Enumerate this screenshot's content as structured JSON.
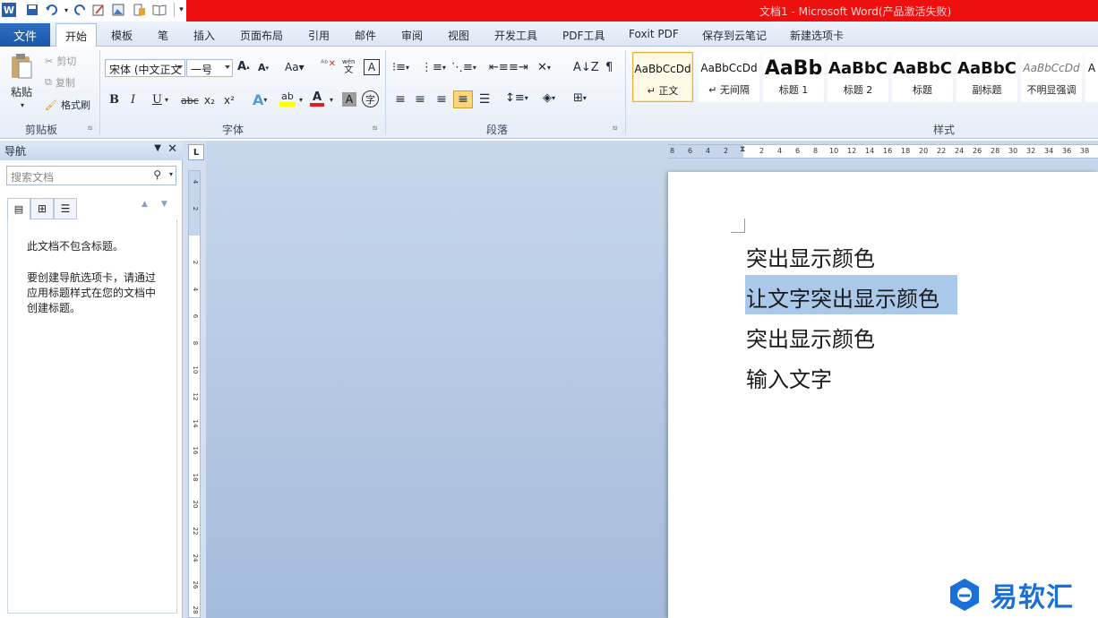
{
  "window": {
    "title": "文档1 - Microsoft Word(产品激活失败)"
  },
  "tabs": {
    "file": "文件",
    "home": "开始",
    "others": [
      "模板",
      "笔",
      "插入",
      "页面布局",
      "引用",
      "邮件",
      "审阅",
      "视图",
      "开发工具",
      "PDF工具",
      "Foxit PDF",
      "保存到云笔记",
      "新建选项卡"
    ]
  },
  "clipboard": {
    "paste": "粘贴",
    "cut": "剪切",
    "copy": "复制",
    "format_painter": "格式刷",
    "label": "剪贴板"
  },
  "font": {
    "name": "宋体 (中文正文",
    "size": "一号",
    "label": "字体",
    "grow": "A",
    "shrink": "A",
    "case": "Aa",
    "bold": "B",
    "italic": "I",
    "underline": "U",
    "strike": "abc",
    "subscript": "x₂",
    "superscript": "x²",
    "phonetic": "wén",
    "border_char": "A",
    "highlight": "ab",
    "color": "A",
    "shade": "A",
    "enclose": "字",
    "clear": "A",
    "highlight_color": "#ffff00",
    "font_color": "#e02020"
  },
  "paragraph": {
    "label": "段落"
  },
  "styles": {
    "label": "样式",
    "items": [
      {
        "preview": "AaBbCcDd",
        "name": "↵ 正文"
      },
      {
        "preview": "AaBbCcDd",
        "name": "↵ 无间隔"
      },
      {
        "preview": "AaBb",
        "name": "标题 1"
      },
      {
        "preview": "AaBbC",
        "name": "标题 2"
      },
      {
        "preview": "AaBbC",
        "name": "标题"
      },
      {
        "preview": "AaBbC",
        "name": "副标题"
      },
      {
        "preview": "AaBbCcDd",
        "name": "不明显强调"
      }
    ]
  },
  "nav": {
    "title": "导航",
    "search_placeholder": "搜索文档",
    "message1": "此文档不包含标题。",
    "message2": [
      "要创建导航选项卡，请通过",
      "应用标题样式在您的文档中",
      "创建标题。"
    ]
  },
  "ruler": {
    "h": [
      "8",
      "6",
      "4",
      "2",
      "",
      "2",
      "4",
      "6",
      "8",
      "10",
      "12",
      "14",
      "16",
      "18",
      "20",
      "22",
      "24",
      "26",
      "28",
      "30",
      "32",
      "34",
      "36",
      "38"
    ],
    "v": [
      "4",
      "2",
      "",
      "2",
      "4",
      "6",
      "8",
      "10",
      "12",
      "14",
      "16",
      "18",
      "20",
      "22",
      "24",
      "26",
      "28"
    ]
  },
  "document": {
    "lines": [
      "突出显示颜色",
      "让文字突出显示颜色",
      "突出显示颜色",
      "输入文字"
    ],
    "selection_color": "#a9c8ea"
  },
  "watermark": {
    "text": "易软汇",
    "color": "#1b6fd8"
  }
}
